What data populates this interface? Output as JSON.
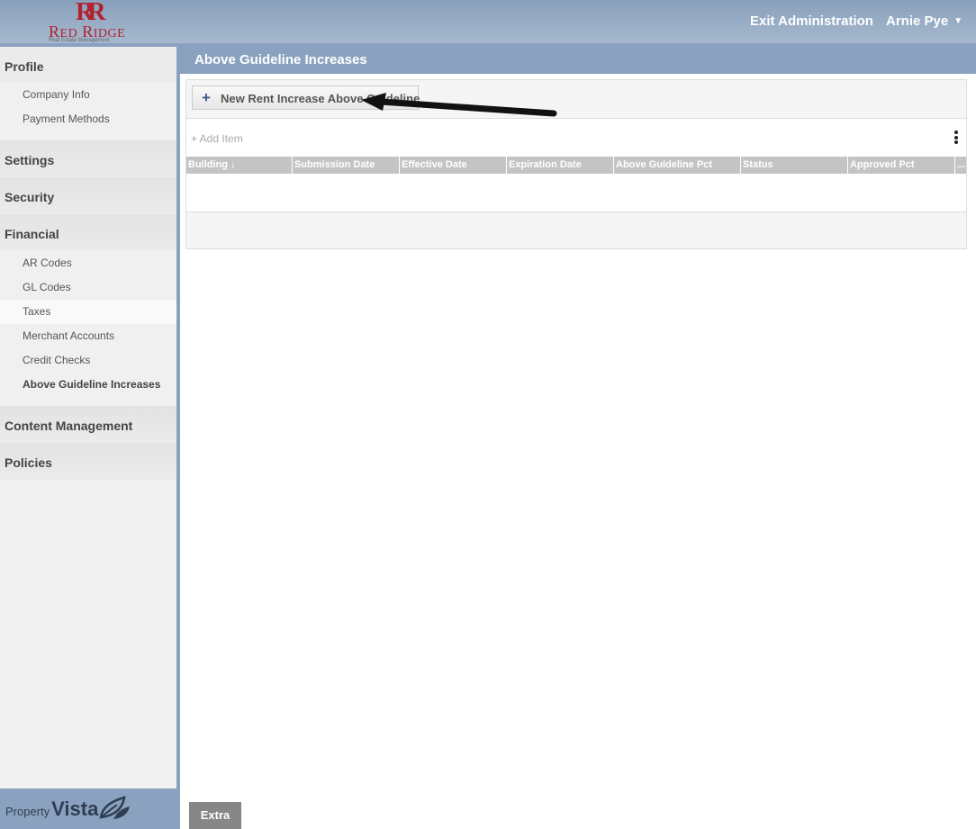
{
  "header": {
    "logo_mark": "RR",
    "logo_name_first": "R",
    "logo_name_first_rest": "ED",
    "logo_name_second": "R",
    "logo_name_second_rest": "IDGE",
    "logo_tagline": "Real Estate Management",
    "exit_label": "Exit Administration",
    "user_label": "Arnie Pye",
    "user_caret": "▼"
  },
  "sidebar": {
    "sections": [
      {
        "label": "Profile",
        "items": [
          "Company Info",
          "Payment Methods"
        ]
      },
      {
        "label": "Settings"
      },
      {
        "label": "Security"
      },
      {
        "label": "Financial",
        "items": [
          "AR Codes",
          "GL Codes",
          "Taxes",
          "Merchant Accounts",
          "Credit Checks",
          "Above Guideline Increases"
        ]
      },
      {
        "label": "Content Management"
      },
      {
        "label": "Policies"
      }
    ],
    "active_item": "Above Guideline Increases",
    "footer_logo_a": "Property",
    "footer_logo_b": "Vista"
  },
  "main": {
    "title": "Above Guideline Increases",
    "new_button_label": "New Rent Increase Above Guideline",
    "add_item_label": "+ Add Item",
    "columns": [
      "Building ↓",
      "Submission Date",
      "Effective Date",
      "Expiration Date",
      "Above Guideline Pct",
      "Status",
      "Approved Pct",
      "..."
    ],
    "extra_label": "Extra"
  },
  "colors": {
    "header_bg": "#8aa2bf",
    "brand_red": "#b2232f",
    "column_header_bg": "#c4c4c4",
    "extra_bg": "#868686"
  }
}
